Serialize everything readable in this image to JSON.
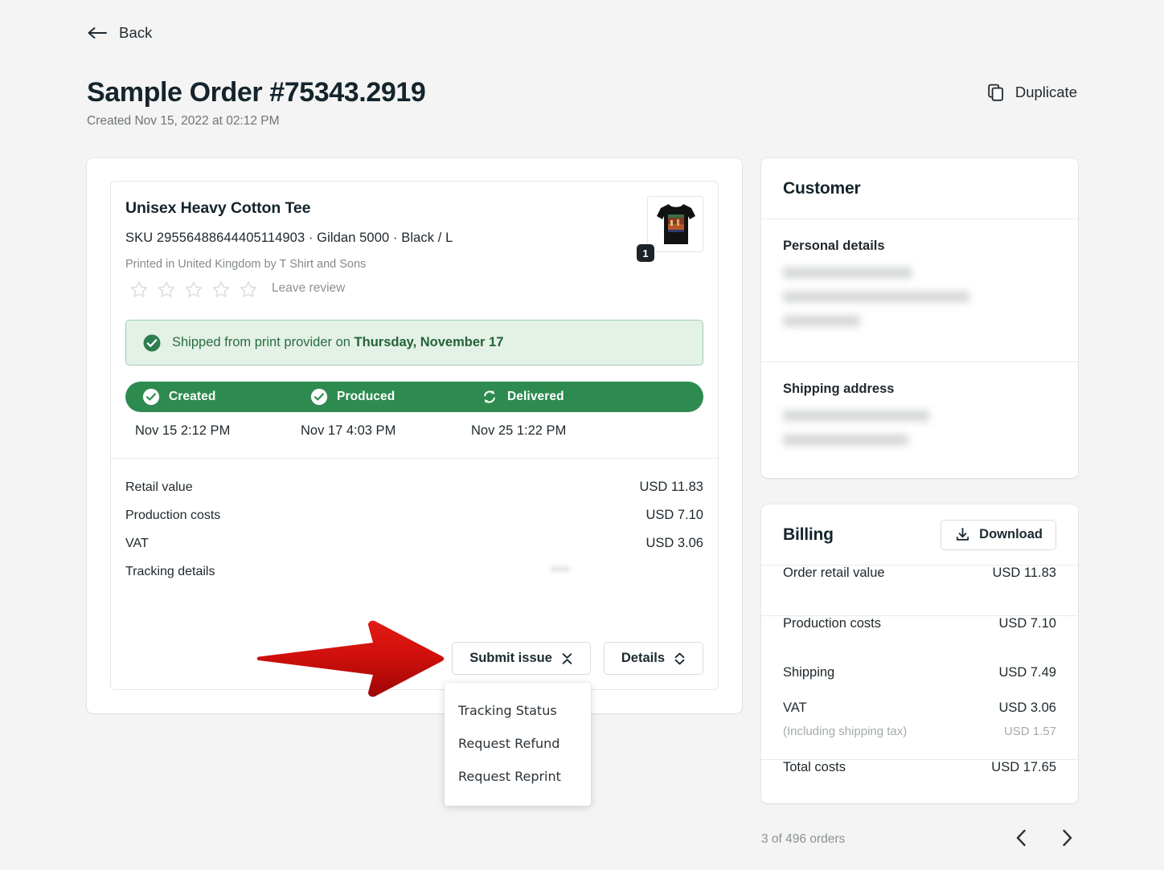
{
  "nav": {
    "back_label": "Back"
  },
  "header": {
    "title": "Sample Order #75343.2919",
    "created": "Created Nov 15, 2022 at 02:12 PM",
    "duplicate_label": "Duplicate"
  },
  "item": {
    "title": "Unisex Heavy Cotton Tee",
    "sku": "SKU 29556488644405114903  · Gildan 5000 · Black / L",
    "printed_by": "Printed in United Kingdom by T Shirt and Sons",
    "leave_review": "Leave review",
    "stars_filled": 0,
    "stars_total": 5,
    "quantity": "1"
  },
  "shipping_banner": {
    "prefix": "Shipped from print provider on ",
    "date": "Thursday, November 17"
  },
  "progress": {
    "stages": [
      {
        "label": "Created",
        "icon": "check-circle-icon",
        "time": "Nov 15 2:12 PM"
      },
      {
        "label": "Produced",
        "icon": "check-circle-icon",
        "time": "Nov 17 4:03 PM"
      },
      {
        "label": "Delivered",
        "icon": "sync-icon",
        "time": "Nov 25 1:22 PM"
      }
    ],
    "bar_color": "#2e8b4f"
  },
  "costs": [
    {
      "label": "Retail value",
      "value": "USD 11.83"
    },
    {
      "label": "Production costs",
      "value": "USD 7.10"
    },
    {
      "label": "VAT",
      "value": "USD 3.06"
    },
    {
      "label": "Tracking details",
      "value": ""
    }
  ],
  "actions": {
    "submit_issue_label": "Submit issue",
    "details_label": "Details"
  },
  "dropdown": {
    "items": [
      "Tracking Status",
      "Request Refund",
      "Request Reprint"
    ]
  },
  "customer": {
    "title": "Customer",
    "personal_details_label": "Personal details",
    "personal_details_lines": 3,
    "shipping_address_label": "Shipping address",
    "shipping_address_lines": 2
  },
  "billing": {
    "title": "Billing",
    "download_label": "Download",
    "rows": [
      {
        "label": "Order retail value",
        "value": "USD 11.83"
      },
      {
        "label": "Production costs",
        "value": "USD 7.10"
      },
      {
        "label": "Shipping",
        "value": "USD 7.49"
      },
      {
        "label": "VAT",
        "value": "USD 3.06"
      },
      {
        "label": "Total costs",
        "value": "USD 17.65"
      }
    ],
    "vat_note_label": "(Including shipping tax)",
    "vat_note_value": "USD 1.57"
  },
  "footer": {
    "count": "3 of 496 orders"
  },
  "annotation": {
    "arrow_color": "#cf1010"
  }
}
